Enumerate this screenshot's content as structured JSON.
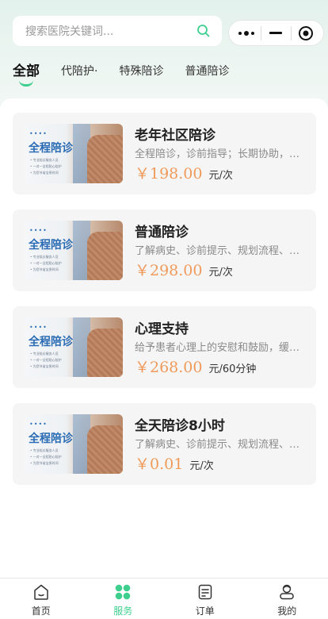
{
  "search": {
    "placeholder": "搜索医院关键词..."
  },
  "tabs": [
    {
      "label": "全部"
    },
    {
      "label": "代陪护·"
    },
    {
      "label": "特殊陪诊"
    },
    {
      "label": "普通陪诊"
    }
  ],
  "services": [
    {
      "title": "老年社区陪诊",
      "desc": "全程陪诊，诊前指导；长期协助，…",
      "price": "￥198.00",
      "unit": "元/次"
    },
    {
      "title": "普通陪诊",
      "desc": "了解病史、诊前提示、规划流程、…",
      "price": "￥298.00",
      "unit": "元/次"
    },
    {
      "title": "心理支持",
      "desc": "给予患者心理上的安慰和鼓励，缓…",
      "price": "￥268.00",
      "unit": "元/60分钟"
    },
    {
      "title": "全天陪诊8小时",
      "desc": "了解病史、诊前提示、规划流程、…",
      "price": "￥0.01",
      "unit": "元/次"
    }
  ],
  "thumbnail": {
    "dots": "••••",
    "heading": "全程陪诊",
    "lines": [
      "• 专业陪诊服务人员",
      "• 一对一全程贴心陪护",
      "• 为您节省宝贵时间"
    ]
  },
  "tabbar": [
    {
      "label": "首页",
      "icon": "home-icon"
    },
    {
      "label": "服务",
      "icon": "grid-icon"
    },
    {
      "label": "订单",
      "icon": "order-icon"
    },
    {
      "label": "我的",
      "icon": "user-icon"
    }
  ],
  "colors": {
    "accent": "#3ecf8e",
    "price": "#f09a5a"
  }
}
